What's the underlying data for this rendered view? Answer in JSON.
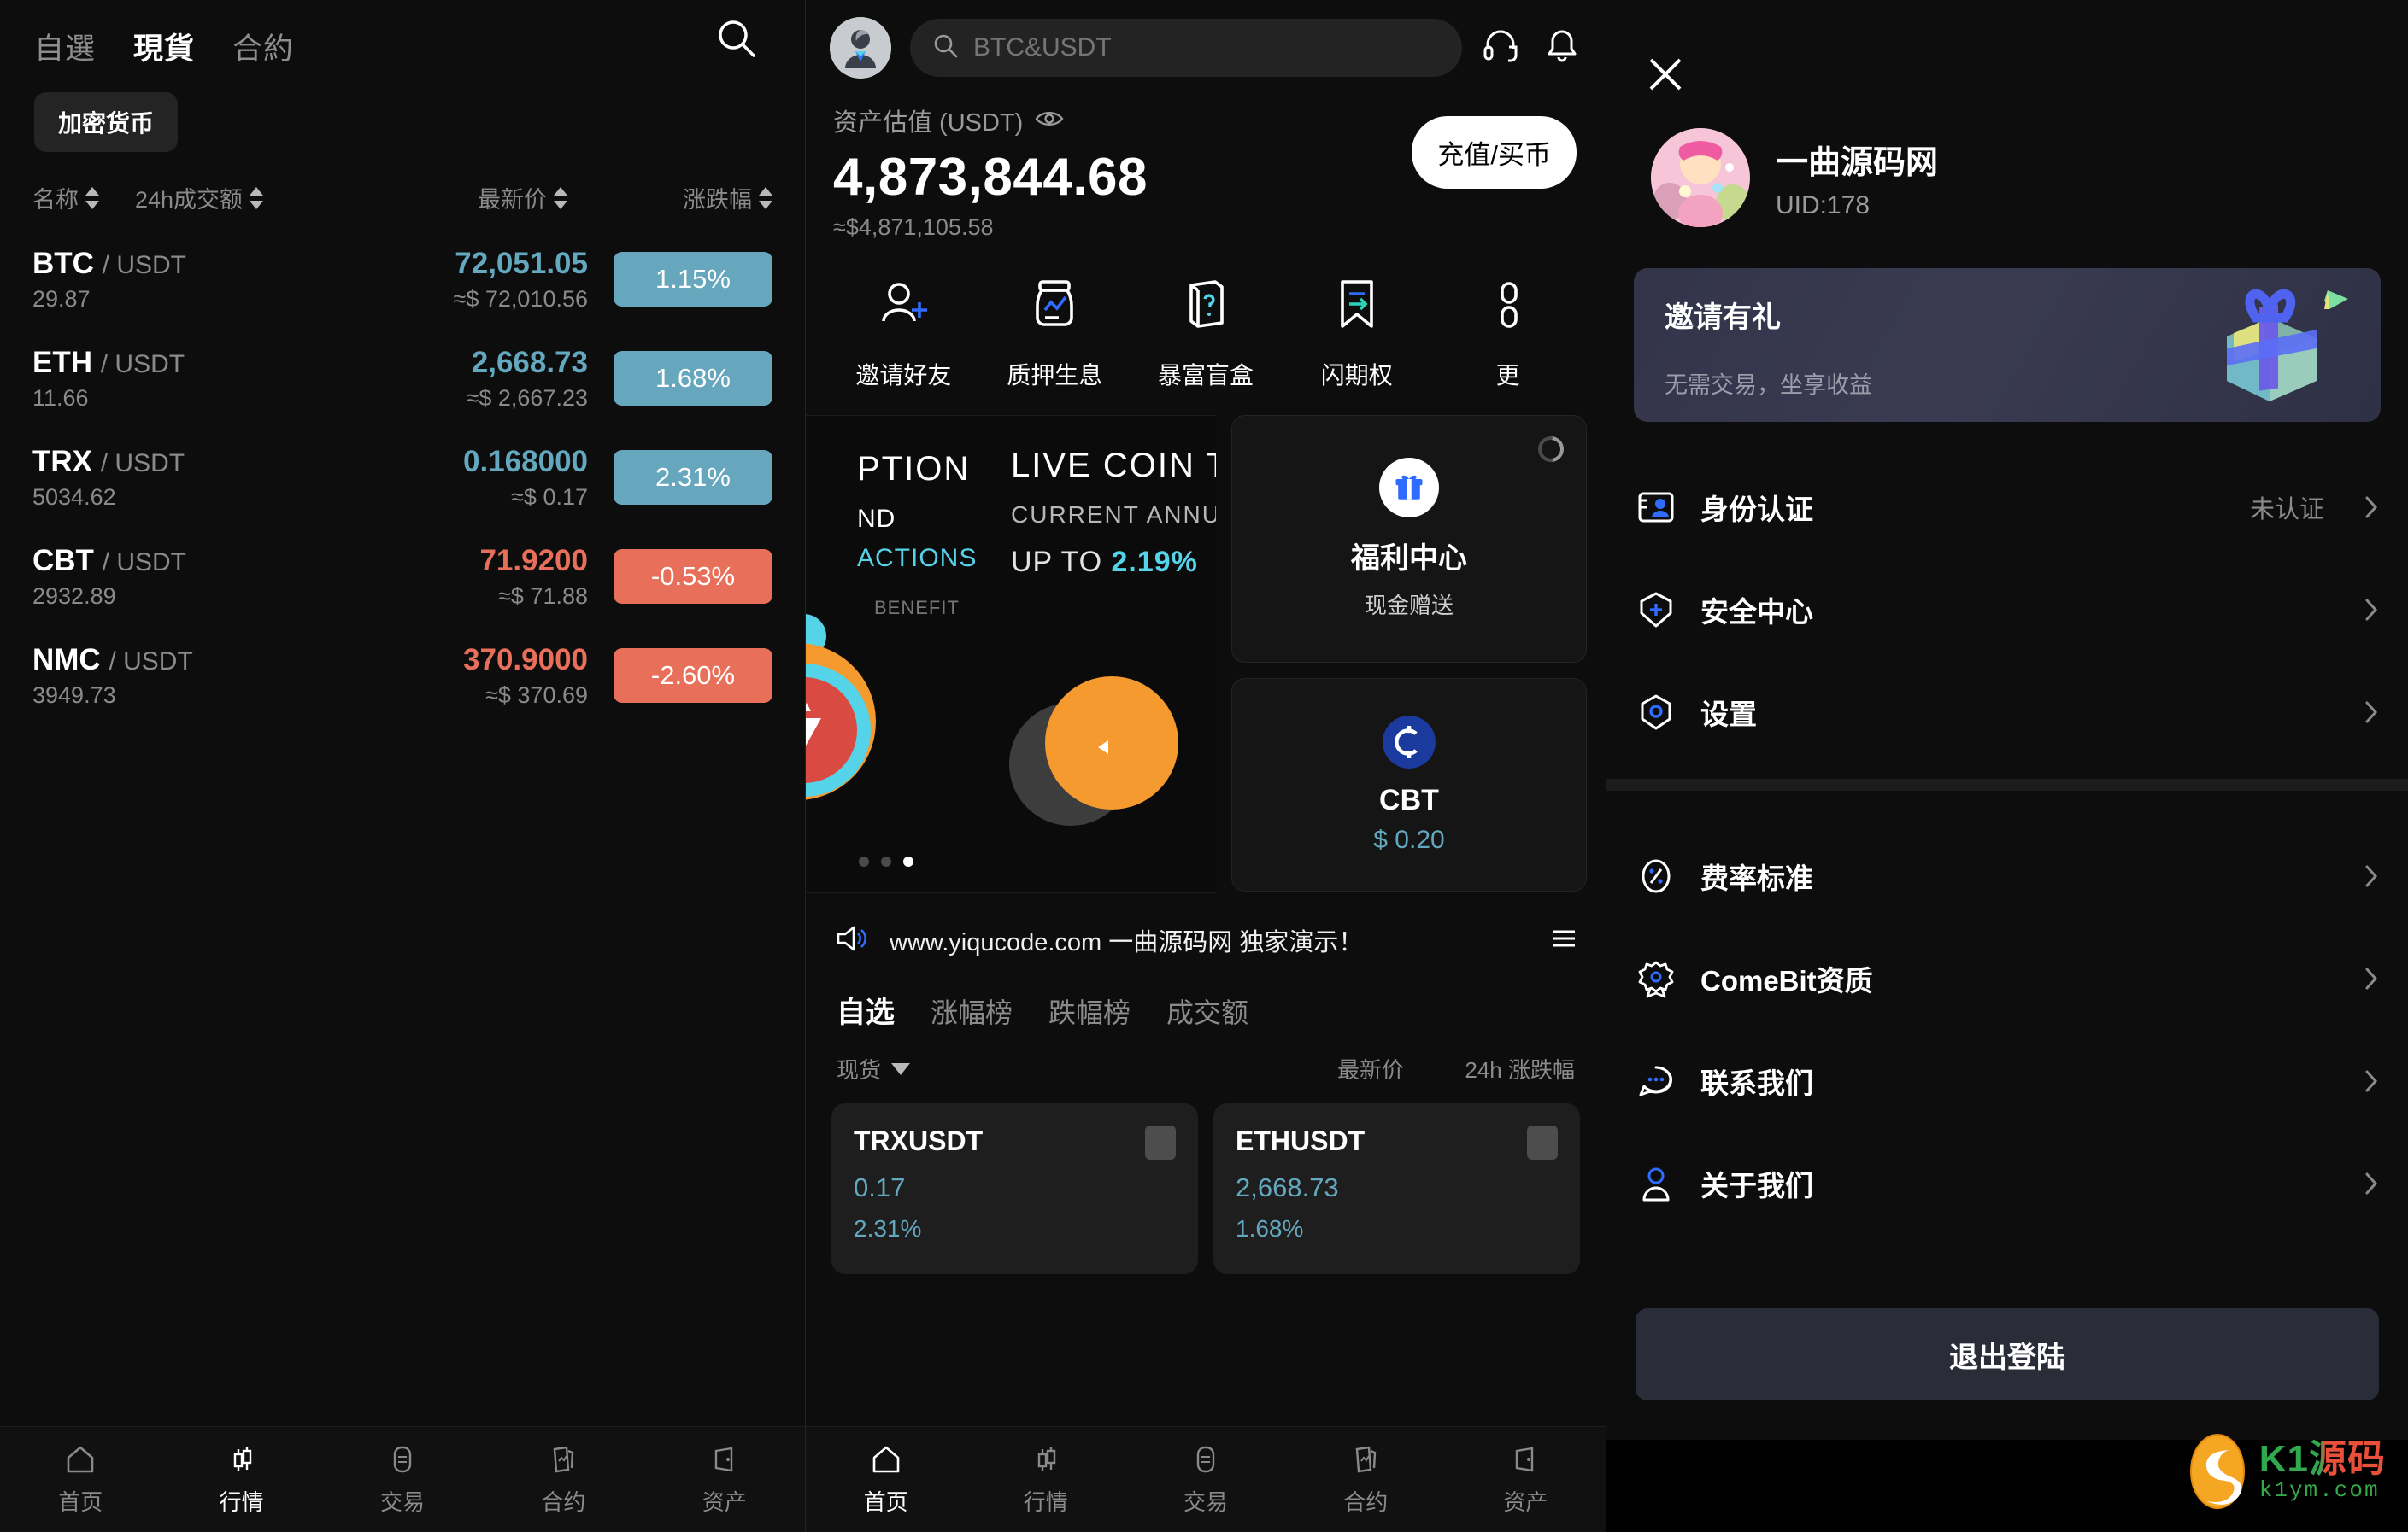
{
  "left_panel": {
    "tabs": [
      {
        "label": "自選",
        "active": false
      },
      {
        "label": "現貨",
        "active": true
      },
      {
        "label": "合約",
        "active": false
      }
    ],
    "search_icon": "search-icon",
    "category_chip": "加密货币",
    "columns": {
      "name": "名称",
      "volume_24h": "24h成交额",
      "last_price": "最新价",
      "change": "涨跌幅"
    },
    "coins": [
      {
        "symbol": "BTC",
        "quote": "/ USDT",
        "volume": "29.87",
        "price": "72,051.05",
        "usd": "≈$ 72,010.56",
        "change": "1.15%",
        "direction": "up"
      },
      {
        "symbol": "ETH",
        "quote": "/ USDT",
        "volume": "11.66",
        "price": "2,668.73",
        "usd": "≈$ 2,667.23",
        "change": "1.68%",
        "direction": "up"
      },
      {
        "symbol": "TRX",
        "quote": "/ USDT",
        "volume": "5034.62",
        "price": "0.168000",
        "usd": "≈$ 0.17",
        "change": "2.31%",
        "direction": "up"
      },
      {
        "symbol": "CBT",
        "quote": "/ USDT",
        "volume": "2932.89",
        "price": "71.9200",
        "usd": "≈$ 71.88",
        "change": "-0.53%",
        "direction": "down"
      },
      {
        "symbol": "NMC",
        "quote": "/ USDT",
        "volume": "3949.73",
        "price": "370.9000",
        "usd": "≈$ 370.69",
        "change": "-2.60%",
        "direction": "down"
      }
    ],
    "bottom_nav": [
      {
        "label": "首页",
        "icon": "home-icon",
        "active": false
      },
      {
        "label": "行情",
        "icon": "candlestick-icon",
        "active": true
      },
      {
        "label": "交易",
        "icon": "exchange-icon",
        "active": false
      },
      {
        "label": "合约",
        "icon": "contract-icon",
        "active": false
      },
      {
        "label": "资产",
        "icon": "wallet-icon",
        "active": false
      }
    ]
  },
  "middle_panel": {
    "avatar_icon": "user-avatar-icon",
    "search": {
      "value": "BTC&USDT",
      "placeholder": "BTC&USDT",
      "icon": "search-icon"
    },
    "header_icons": [
      {
        "name": "headset-icon"
      },
      {
        "name": "bell-icon"
      }
    ],
    "asset": {
      "label": "资产估值 (USDT)",
      "eye_icon": "eye-icon",
      "value": "4,873,844.68",
      "usd": "≈$4,871,105.58",
      "deposit_button": "充值/买币"
    },
    "quick_actions": [
      {
        "label": "邀请好友",
        "icon": "add-user-icon"
      },
      {
        "label": "质押生息",
        "icon": "stake-jar-icon"
      },
      {
        "label": "暴富盲盒",
        "icon": "mystery-box-icon"
      },
      {
        "label": "闪期权",
        "icon": "bookmark-flash-icon"
      },
      {
        "label": "更",
        "icon": "more-icon"
      }
    ],
    "banner": {
      "title_left": "PTION",
      "sub_line1": "ND",
      "sub_line2": "ACTIONS",
      "sub_line3": "BENEFIT",
      "title_right": "LIVE COIN TRE",
      "annual_label": "CURRENT ANNUAL",
      "rate_prefix": "UP TO ",
      "rate_value": "2.19%",
      "dots_total": 3,
      "dots_active_index": 2
    },
    "welfare_card": {
      "icon": "gift-icon",
      "title": "福利中心",
      "subtitle": "现金赠送",
      "refresh_icon": "refresh-icon"
    },
    "cbt_card": {
      "icon": "cbt-coin-icon",
      "name": "CBT",
      "price": "$ 0.20"
    },
    "notice": {
      "speaker_icon": "speaker-icon",
      "text": "www.yiqucode.com 一曲源码网 独家演示！",
      "menu_icon": "hamburger-icon"
    },
    "market_tabs": [
      {
        "label": "自选",
        "active": true
      },
      {
        "label": "涨幅榜",
        "active": false
      },
      {
        "label": "跌幅榜",
        "active": false
      },
      {
        "label": "成交额",
        "active": false
      }
    ],
    "market_columns": {
      "type": "现货",
      "price": "最新价",
      "change": "24h 涨跌幅"
    },
    "market_cards": [
      {
        "symbol": "TRXUSDT",
        "price": "0.17",
        "change": "2.31%"
      },
      {
        "symbol": "ETHUSDT",
        "price": "2,668.73",
        "change": "1.68%"
      }
    ],
    "bottom_nav": [
      {
        "label": "首页",
        "icon": "home-icon",
        "active": true
      },
      {
        "label": "行情",
        "icon": "candlestick-icon",
        "active": false
      },
      {
        "label": "交易",
        "icon": "exchange-icon",
        "active": false
      },
      {
        "label": "合约",
        "icon": "contract-icon",
        "active": false
      },
      {
        "label": "资产",
        "icon": "wallet-icon",
        "active": false
      }
    ]
  },
  "right_panel": {
    "close_icon": "close-icon",
    "profile": {
      "name": "一曲源码网",
      "uid": "UID:178",
      "avatar_icon": "profile-photo"
    },
    "invite": {
      "title": "邀请有礼",
      "subtitle": "无需交易，坐享收益",
      "image": "gift-box-image"
    },
    "menu_group_1": [
      {
        "label": "身份认证",
        "icon": "id-card-icon",
        "value": "未认证"
      },
      {
        "label": "安全中心",
        "icon": "shield-plus-icon",
        "value": ""
      },
      {
        "label": "设置",
        "icon": "hex-gear-icon",
        "value": ""
      }
    ],
    "menu_group_2": [
      {
        "label": "费率标准",
        "icon": "percent-icon",
        "value": ""
      },
      {
        "label": "ComeBit资质",
        "icon": "badge-icon",
        "value": ""
      },
      {
        "label": "联系我们",
        "icon": "chat-icon",
        "value": ""
      },
      {
        "label": "关于我们",
        "icon": "person-icon",
        "value": ""
      }
    ],
    "logout_button": "退出登陆",
    "watermark": {
      "top": "K1源码",
      "bottom": "k1ym.com"
    }
  },
  "colors": {
    "up": "#66a7bd",
    "down": "#e8705b",
    "accent_blue": "#2f6bff",
    "cyan": "#55d3e8",
    "bg": "#0d0d0d"
  }
}
